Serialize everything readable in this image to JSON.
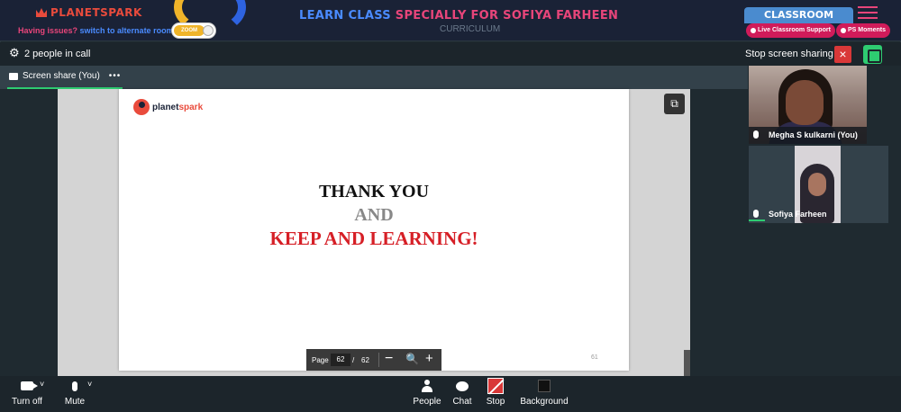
{
  "banner": {
    "brand": "PLANETSPARK",
    "title_blue": "LEARN CLASS",
    "title_pink": "SPECIALLY FOR SOFIYA FARHEEN",
    "curriculum": "CURRICULUM",
    "classroom_label": "CLASSROOM",
    "issue_text": "Having issues?",
    "switch_text": "switch to alternate room",
    "toggle_label": "ZOOM",
    "live_support": "Live Classroom Support",
    "ps_moments": "PS Moments"
  },
  "call": {
    "people_count": "2 people in call",
    "stop_sharing": "Stop screen sharing",
    "close_glyph": "×",
    "tab_label": "Screen share (You)",
    "tab_more": "•••"
  },
  "slide": {
    "logo_pre": "planet",
    "logo_post": "spark",
    "line1": "THANK YOU",
    "line2": "AND",
    "line3": "KEEP AND LEARNING!",
    "slide_number": "61"
  },
  "pager": {
    "label": "Page",
    "current": "62",
    "separator": "/",
    "total": "62",
    "minus": "−",
    "zoom": "🔍",
    "plus": "+"
  },
  "participants": [
    {
      "name": "Megha S kulkarni (You)"
    },
    {
      "name": "Sofiya Farheen"
    }
  ],
  "toolbar": {
    "turn_off": "Turn off",
    "mute": "Mute",
    "people": "People",
    "chat": "Chat",
    "stop": "Stop",
    "background": "Background",
    "chevron": "˅"
  },
  "colors": {
    "accent_green": "#2ecc71",
    "danger_red": "#d93838",
    "brand_pink": "#e8457a",
    "brand_blue": "#4a8bff"
  }
}
